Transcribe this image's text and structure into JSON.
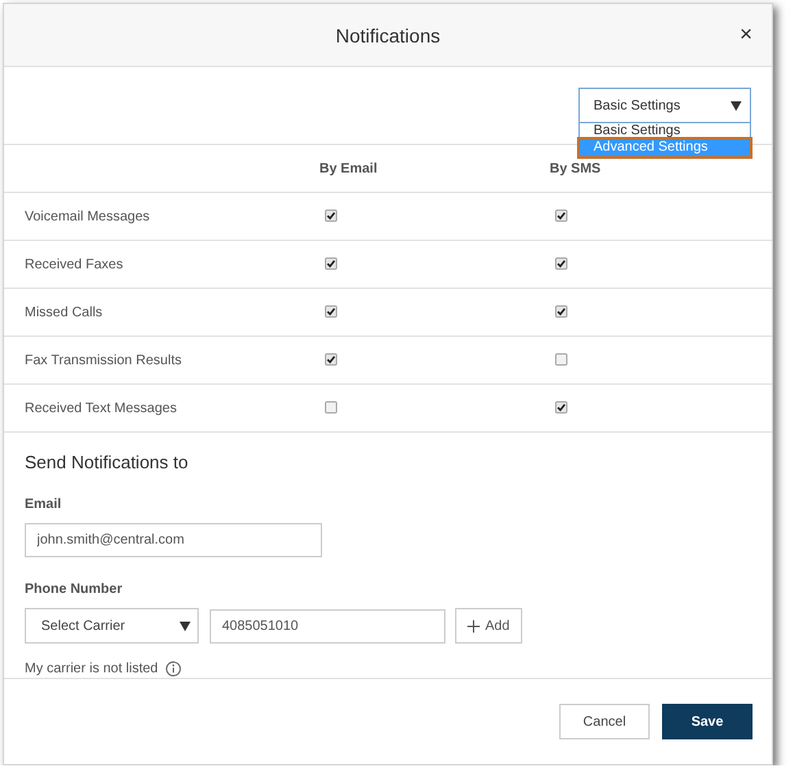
{
  "dialog": {
    "title": "Notifications",
    "close": "×"
  },
  "settings_select": {
    "value": "Basic Settings",
    "expanded": true,
    "options": [
      {
        "label": "Basic Settings",
        "highlighted": false
      },
      {
        "label": "Advanced Settings",
        "highlighted": true
      }
    ]
  },
  "columns": [
    "By Email",
    "By SMS"
  ],
  "rows": [
    {
      "label": "Voicemail Messages",
      "email": true,
      "sms": true
    },
    {
      "label": "Received Faxes",
      "email": true,
      "sms": true
    },
    {
      "label": "Missed Calls",
      "email": true,
      "sms": true
    },
    {
      "label": "Fax Transmission Results",
      "email": true,
      "sms": false
    },
    {
      "label": "Received Text Messages",
      "email": false,
      "sms": true
    }
  ],
  "send_section": {
    "title": "Send Notifications to",
    "email_label": "Email",
    "email_value": "john.smith@central.com",
    "phone_label": "Phone Number",
    "carrier_select": "Select Carrier",
    "phone_value": "4085051010",
    "add_button": "Add",
    "note": "My carrier is not listed"
  },
  "buttons": [
    {
      "label": "Cancel",
      "kind": "secondary"
    },
    {
      "label": "Save",
      "kind": "primary"
    }
  ]
}
